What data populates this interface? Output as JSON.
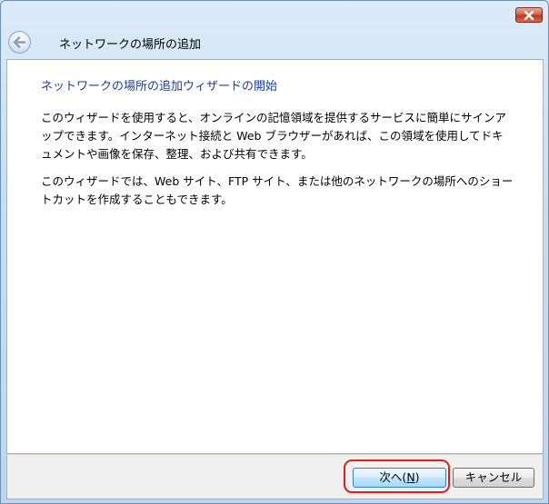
{
  "window": {
    "title": "ネットワークの場所の追加",
    "close_label": "閉じる"
  },
  "wizard": {
    "heading": "ネットワークの場所の追加ウィザードの開始",
    "paragraph1": "このウィザードを使用すると、オンラインの記憶領域を提供するサービスに簡単にサインアップできます。インターネット接続と Web ブラウザーがあれば、この領域を使用してドキュメントや画像を保存、整理、および共有できます。",
    "paragraph2": "このウィザードでは、Web サイト、FTP サイト、または他のネットワークの場所へのショートカットを作成することもできます。"
  },
  "buttons": {
    "next_prefix": "次へ(",
    "next_accel": "N",
    "next_suffix": ")",
    "cancel": "キャンセル"
  },
  "colors": {
    "heading": "#1e3f93",
    "highlight": "#e21d1d"
  },
  "icons": {
    "back": "back-arrow-icon",
    "close": "close-x-icon"
  }
}
